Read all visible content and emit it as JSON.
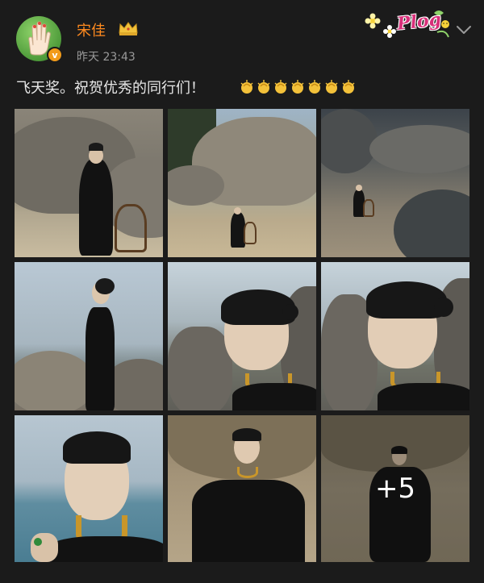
{
  "user": {
    "name": "宋佳",
    "verified_mark": "v",
    "timestamp": "昨天 23:43"
  },
  "header": {
    "sticker_text": "Plog",
    "menu_icon": "chevron-down-icon"
  },
  "post": {
    "text": "飞天奖。祝贺优秀的同行们！",
    "clap_emoji_count": 7
  },
  "gallery": {
    "total_visible": 9,
    "more_count": "+5"
  },
  "colors": {
    "background": "#1b1b1b",
    "username": "#ff8a1f",
    "timestamp": "#9a9a9a",
    "text": "#e6e6e6"
  }
}
